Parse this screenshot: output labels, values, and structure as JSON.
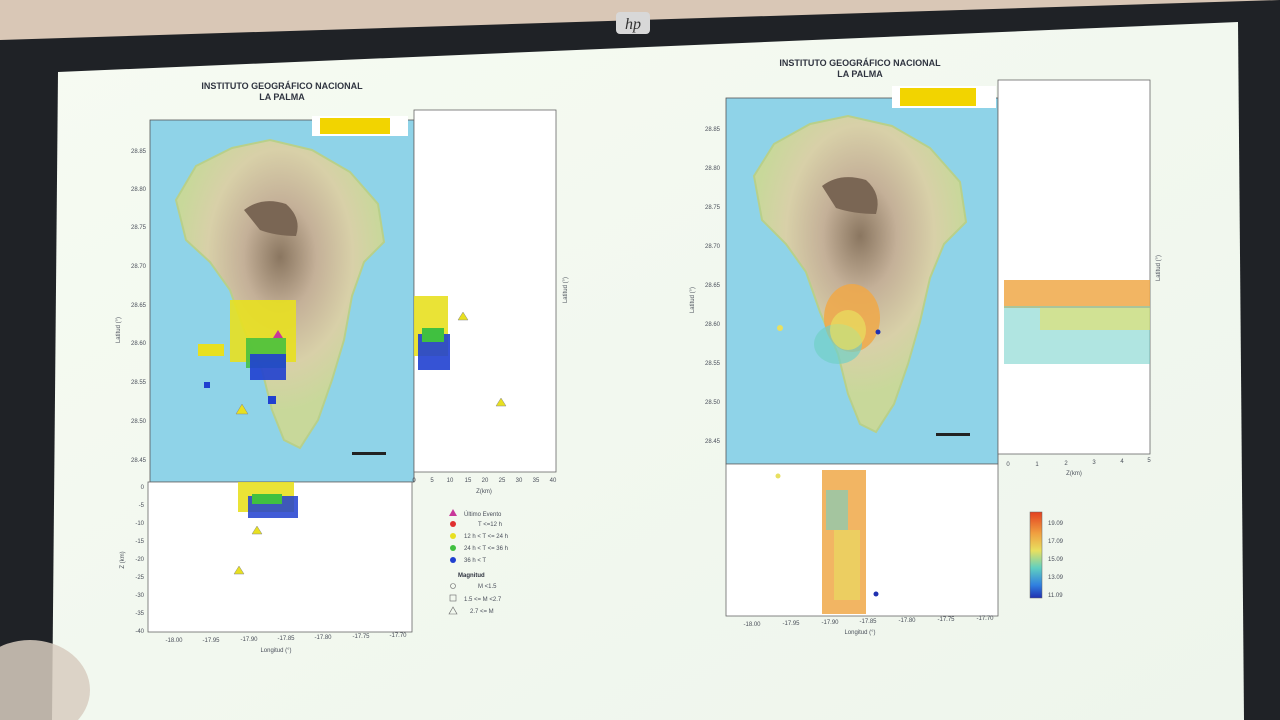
{
  "monitor": {
    "brand_logo": "hp-logo"
  },
  "left_panel": {
    "title_line1": "INSTITUTO GEOGRÁFICO NACIONAL",
    "title_line2": "LA PALMA",
    "lat_ticks": [
      "28.85",
      "28.80",
      "28.75",
      "28.70",
      "28.65",
      "28.60",
      "28.55",
      "28.50",
      "28.45"
    ],
    "lon_ticks": [
      "-18.00",
      "-17.95",
      "-17.90",
      "-17.85",
      "-17.80",
      "-17.75",
      "-17.70"
    ],
    "depth_ticks": [
      "0",
      "-5",
      "-10",
      "-15",
      "-20",
      "-25",
      "-30",
      "-35",
      "-40"
    ],
    "z_ticks": [
      "0",
      "5",
      "10",
      "15",
      "20",
      "25",
      "30",
      "35",
      "40"
    ],
    "lat_label": "Latitud (°)",
    "lon_label": "Longitud (°)",
    "depth_label": "Z (km)",
    "z_label": "Z(km)",
    "legend": {
      "time_items": [
        "Último Evento",
        "T <=12 h",
        "12 h < T <= 24 h",
        "24 h < T <= 36 h",
        "36 h < T"
      ],
      "time_colors": [
        "#c8389a",
        "#e03030",
        "#e8e020",
        "#40c040",
        "#2040d0"
      ],
      "mag_title": "Magnitud",
      "mag_items": [
        "M <1.5",
        "1.5 <= M <2.7",
        "2.7 <= M"
      ]
    }
  },
  "right_panel": {
    "title_line1": "INSTITUTO GEOGRÁFICO NACIONAL",
    "title_line2": "LA PALMA",
    "lat_ticks": [
      "28.85",
      "28.80",
      "28.75",
      "28.70",
      "28.65",
      "28.60",
      "28.55",
      "28.50",
      "28.45"
    ],
    "lon_ticks": [
      "-18.00",
      "-17.95",
      "-17.90",
      "-17.85",
      "-17.80",
      "-17.75",
      "-17.70"
    ],
    "z_ticks": [
      "0",
      "1",
      "2",
      "3",
      "4",
      "5"
    ],
    "lat_label": "Latitud (°)",
    "lon_label": "Longitud (°)",
    "z_label": "Z(km)",
    "colorbar_ticks": [
      "19.09",
      "17.09",
      "15.09",
      "13.09",
      "11.09"
    ]
  }
}
